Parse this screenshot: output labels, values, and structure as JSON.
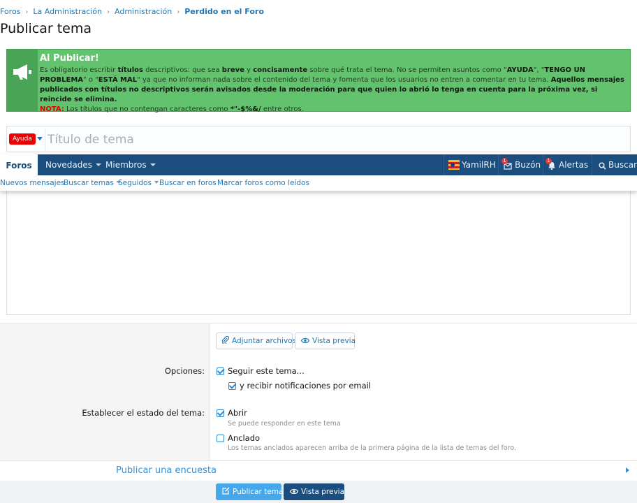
{
  "breadcrumb": [
    "Foros",
    "La Administración",
    "Administración",
    "Perdido en el Foro"
  ],
  "page_title": "Publicar tema",
  "notice": {
    "title": "Al Publicar!",
    "p1": "Es obligatorio escribir ",
    "b1": "títulos",
    "p2": " descriptivos: que sea ",
    "b2": "breve",
    "p3": " y ",
    "b3": "concisamente",
    "p4": " sobre qué trata el tema. No se permiten asuntos como \"",
    "b4": "AYUDA",
    "p5": "\", \"",
    "b5": "TENGO UN PROBLEMA",
    "p6": "\" o \"",
    "b6": "ESTÁ MAL",
    "p7": "\" ya que no informan nada sobre el contenido del tema y fomenta que los usuarios no entren a comentar en tu tema. ",
    "b7": "Aquellos mensajes publicados con títulos no descriptivos serán avisados desde la moderación para que quien lo abrió lo tenga en cuenta para la próxima vez, si reincide se elimina.",
    "nota_label": "NOTA:",
    "nota_text": " Los títulos que no contengan caracteres como ",
    "nota_chars": "*\"-$%&/",
    "nota_end": " entre otros.",
    "accent": "#63c26d"
  },
  "title_field": {
    "prefix": "Ayuda",
    "placeholder": "Título de tema",
    "prefix_color": "#ee0000"
  },
  "nav": {
    "tabs": [
      "Foros",
      "Novedades",
      "Miembros"
    ],
    "user": "YamilRH",
    "inbox_label": "Buzón",
    "inbox_count": "1",
    "alerts_label": "Alertas",
    "alerts_count": "1",
    "search_label": "Buscar",
    "bar_color": "#1b4d7e"
  },
  "subnav": [
    "Nuevos mensajes",
    "Buscar temas",
    "Seguidos",
    "Buscar en foros",
    "Marcar foros como leídos"
  ],
  "attach_label": "Adjuntar archivos",
  "preview_label": "Vista previa",
  "options": {
    "label": "Opciones:",
    "watch": "Seguir este tema...",
    "email": "y recibir notificaciones por email"
  },
  "state": {
    "label": "Establecer el estado del tema:",
    "open": "Abrir",
    "open_hint": "Se puede responder en este tema",
    "sticky": "Anclado",
    "sticky_hint": "Los temas anclados aparecen arriba de la primera página de la lista de temas del foro."
  },
  "poll_label": "Publicar una encuesta",
  "footer": {
    "submit": "Publicar tema",
    "preview": "Vista previa"
  }
}
